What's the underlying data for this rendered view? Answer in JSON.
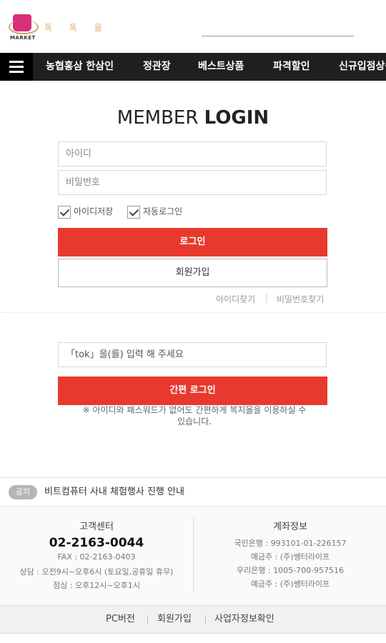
{
  "header": {
    "logo_text": "MARKET",
    "brand_name": "톡 톡 몰"
  },
  "nav": {
    "items": [
      "농협홍삼 한삼인",
      "정관장",
      "베스트상품",
      "파격할인",
      "신규입점상품"
    ]
  },
  "login": {
    "title_light": "MEMBER",
    "title_bold": "LOGIN",
    "id_placeholder": "아이디",
    "pw_placeholder": "비밀번호",
    "save_id": "아이디저장",
    "auto_login": "자동로그인",
    "login_button": "로그인",
    "join_button": "회원가입",
    "find_id": "아이디찾기",
    "find_pw": "비밀번호찾기",
    "find_sep": "|"
  },
  "easy": {
    "placeholder": "「tok」을(를) 입력 해 주세요",
    "button": "간편 로그인",
    "note_line1": "※ 아이디와 패스워드가 없어도 간편하게 복지몰을 이용하실 수",
    "note_line2": "있습니다."
  },
  "notice": {
    "badge": "공지",
    "text": "비트컴퓨터 사내 체험행사 진행 안내"
  },
  "footer": {
    "cs_title": "고객센터",
    "cs_phone": "02-2163-0044",
    "cs_fax": "FAX : 02-2163-0403",
    "cs_hours": "상담 : 오전9시~오후6시 (토요일,공휴일 휴무)",
    "cs_lunch": "점심 : 오후12시~오후1시",
    "acct_title": "계좌정보",
    "acct_bank1": "국민은행 : 993101-01-226157",
    "acct_holder1": "예금주 : (주)쌩터라이프",
    "acct_bank2": "우리은행 : 1005-700-957516",
    "acct_holder2": "예금주 : (주)쌩터라이프"
  },
  "bottom_links": [
    "PC버전",
    "회원가입",
    "사업자정보확인"
  ],
  "colors": {
    "accent_red": "#e8392e",
    "nav_bg": "#1f1f1f"
  }
}
